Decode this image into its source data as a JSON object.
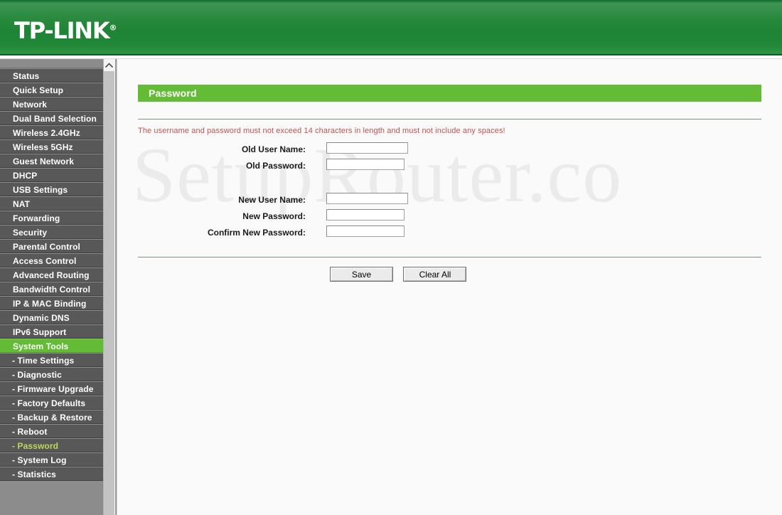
{
  "brand": {
    "logo_text": "TP-LINK",
    "registered_mark": "®"
  },
  "sidebar": {
    "items": [
      {
        "label": "Status",
        "level": "top",
        "state": "normal"
      },
      {
        "label": "Quick Setup",
        "level": "top",
        "state": "normal"
      },
      {
        "label": "Network",
        "level": "top",
        "state": "normal"
      },
      {
        "label": "Dual Band Selection",
        "level": "top",
        "state": "normal"
      },
      {
        "label": "Wireless 2.4GHz",
        "level": "top",
        "state": "normal"
      },
      {
        "label": "Wireless 5GHz",
        "level": "top",
        "state": "normal"
      },
      {
        "label": "Guest Network",
        "level": "top",
        "state": "normal"
      },
      {
        "label": "DHCP",
        "level": "top",
        "state": "normal"
      },
      {
        "label": "USB Settings",
        "level": "top",
        "state": "normal"
      },
      {
        "label": "NAT",
        "level": "top",
        "state": "normal"
      },
      {
        "label": "Forwarding",
        "level": "top",
        "state": "normal"
      },
      {
        "label": "Security",
        "level": "top",
        "state": "normal"
      },
      {
        "label": "Parental Control",
        "level": "top",
        "state": "normal"
      },
      {
        "label": "Access Control",
        "level": "top",
        "state": "normal"
      },
      {
        "label": "Advanced Routing",
        "level": "top",
        "state": "normal"
      },
      {
        "label": "Bandwidth Control",
        "level": "top",
        "state": "normal"
      },
      {
        "label": "IP & MAC Binding",
        "level": "top",
        "state": "normal"
      },
      {
        "label": "Dynamic DNS",
        "level": "top",
        "state": "normal"
      },
      {
        "label": "IPv6 Support",
        "level": "top",
        "state": "normal"
      },
      {
        "label": "System Tools",
        "level": "top",
        "state": "group-active"
      },
      {
        "label": "- Time Settings",
        "level": "sub",
        "state": "normal"
      },
      {
        "label": "- Diagnostic",
        "level": "sub",
        "state": "normal"
      },
      {
        "label": "- Firmware Upgrade",
        "level": "sub",
        "state": "normal"
      },
      {
        "label": "- Factory Defaults",
        "level": "sub",
        "state": "normal"
      },
      {
        "label": "- Backup & Restore",
        "level": "sub",
        "state": "normal"
      },
      {
        "label": "- Reboot",
        "level": "sub",
        "state": "normal"
      },
      {
        "label": "- Password",
        "level": "sub",
        "state": "leaf-active"
      },
      {
        "label": "- System Log",
        "level": "sub",
        "state": "normal"
      },
      {
        "label": "- Statistics",
        "level": "sub",
        "state": "normal"
      }
    ],
    "scroll_up_icon": "chevron-up-icon"
  },
  "main": {
    "page_title": "Password",
    "notice": "The username and password must not exceed 14 characters in length and must not include any spaces!",
    "watermark": "SetupRouter.co",
    "form": {
      "old_user_name_label": "Old User Name:",
      "old_user_name_value": "",
      "old_password_label": "Old Password:",
      "old_password_value": "",
      "new_user_name_label": "New User Name:",
      "new_user_name_value": "",
      "new_password_label": "New Password:",
      "new_password_value": "",
      "confirm_new_password_label": "Confirm New Password:",
      "confirm_new_password_value": ""
    },
    "buttons": {
      "save_label": "Save",
      "clear_all_label": "Clear All"
    }
  },
  "colors": {
    "brand_green": "#1f8335",
    "accent_green": "#63bb36",
    "sidebar_bg": "#585858",
    "notice_red": "#c0504d",
    "active_leaf_text": "#b8d95a"
  }
}
